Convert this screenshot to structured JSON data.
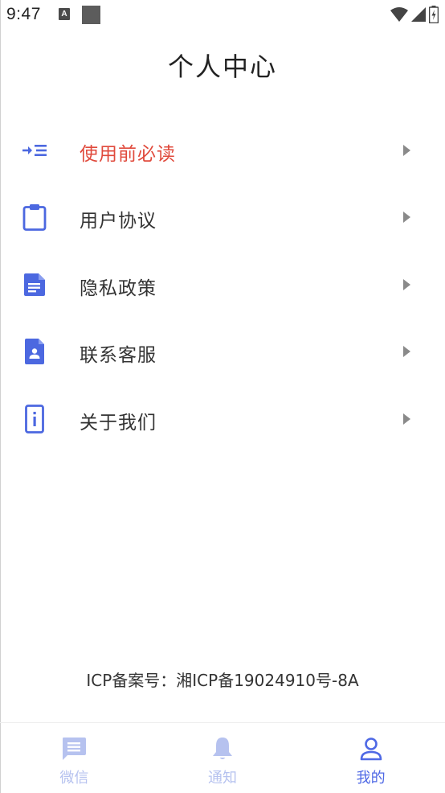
{
  "status_bar": {
    "time": "9:47",
    "a_icon_letter": "A"
  },
  "page": {
    "title": "个人中心"
  },
  "menu": {
    "items": [
      {
        "label": "使用前必读",
        "icon": "indent-list-icon",
        "highlight": true
      },
      {
        "label": "用户协议",
        "icon": "clipboard-icon",
        "highlight": false
      },
      {
        "label": "隐私政策",
        "icon": "document-icon",
        "highlight": false
      },
      {
        "label": "联系客服",
        "icon": "contact-file-icon",
        "highlight": false
      },
      {
        "label": "关于我们",
        "icon": "info-icon",
        "highlight": false
      }
    ]
  },
  "footer": {
    "icp": "ICP备案号：湘ICP备19024910号-8A"
  },
  "tabs": [
    {
      "label": "微信",
      "icon": "chat-icon",
      "active": false
    },
    {
      "label": "通知",
      "icon": "bell-icon",
      "active": false
    },
    {
      "label": "我的",
      "icon": "user-icon",
      "active": true
    }
  ],
  "colors": {
    "accent": "#4f69e5",
    "highlight_text": "#e04a3c",
    "inactive_tab": "#b6c2ef",
    "icon_blue": "#4c68e0"
  }
}
